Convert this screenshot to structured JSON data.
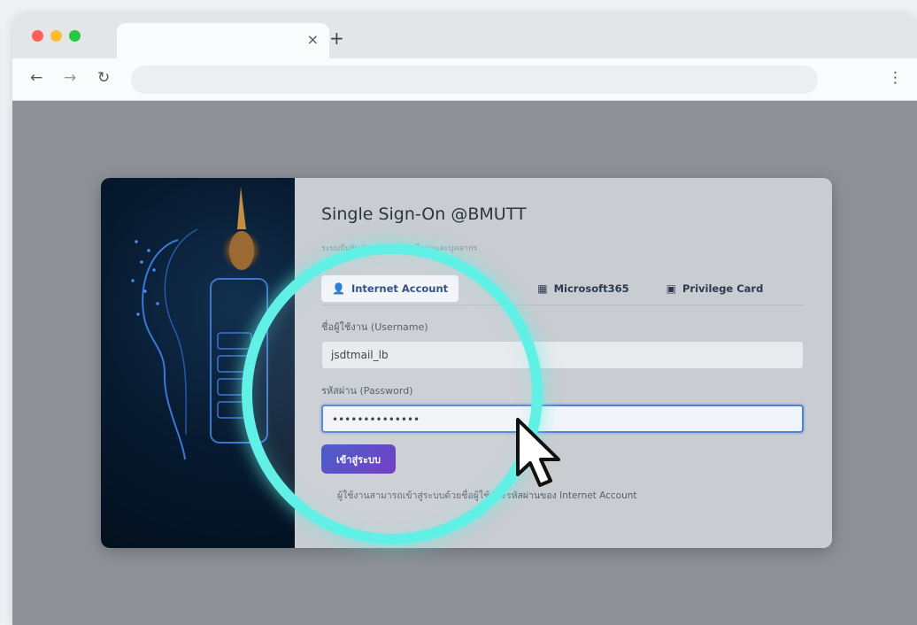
{
  "browser": {
    "tab_close_icon": "×",
    "new_tab_icon": "+",
    "back_icon": "←",
    "forward_icon": "→",
    "reload_icon": "↻",
    "menu_icon": "⋮"
  },
  "sso": {
    "title": "Single Sign-On @BMUTT",
    "subtitle": "ระบบยืนยันตัวตนสำหรับนักศึกษาและบุคลากร",
    "tabs": [
      {
        "icon": "user-icon",
        "label": "Internet Account",
        "active": true
      },
      {
        "icon": "user-circle-icon",
        "label": "",
        "active": false
      },
      {
        "icon": "windows-icon",
        "label": "Microsoft365",
        "active": false
      },
      {
        "icon": "card-icon",
        "label": "Privilege Card",
        "active": false
      }
    ],
    "username_label": "ชื่อผู้ใช้งาน (Username)",
    "username_value": "jsdtmail_lb",
    "password_label": "รหัสผ่าน (Password)",
    "password_value": "••••••••••••••",
    "submit_label": "เข้าสู่ระบบ",
    "note": "ผู้ใช้งานสามารถเข้าสู่ระบบด้วยชื่อผู้ใช้และรหัสผ่านของ Internet Account"
  },
  "colors": {
    "accent": "#4a82d6",
    "highlight_ring": "#61f0e6",
    "button_start": "#3b52c6",
    "button_end": "#6b2fc2"
  }
}
